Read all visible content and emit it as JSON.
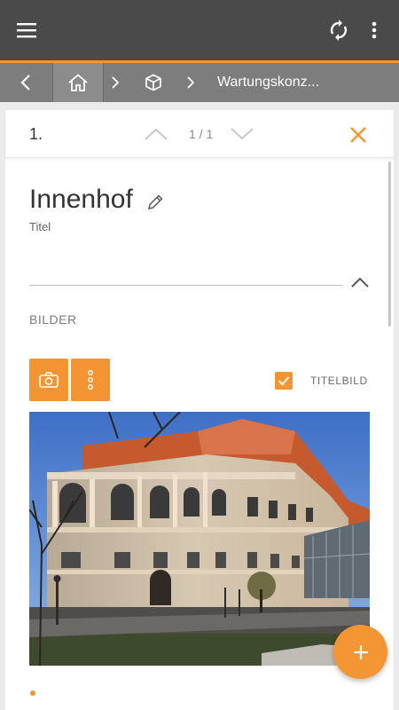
{
  "toolbar": {
    "menu_icon": "menu-icon",
    "sync_icon": "sync-icon",
    "more_icon": "more-vertical-icon"
  },
  "breadcrumb": {
    "back_icon": "chevron-left-icon",
    "home_icon": "home-icon",
    "object_icon": "cube-icon",
    "current_label": "Wartungskonz..."
  },
  "pager": {
    "item_number": "1.",
    "position": "1 / 1"
  },
  "record": {
    "title": "Innenhof",
    "title_field_label": "Titel"
  },
  "images_section": {
    "label": "BILDER",
    "title_image_label": "TITELBILD",
    "title_image_checked": true,
    "photo_description": "Innenhof photo",
    "page_count": 1,
    "current_page": 1
  },
  "colors": {
    "accent": "#f39532",
    "topbar": "#4a4a4a",
    "breadcrumb_bar": "#7d7d7d"
  }
}
